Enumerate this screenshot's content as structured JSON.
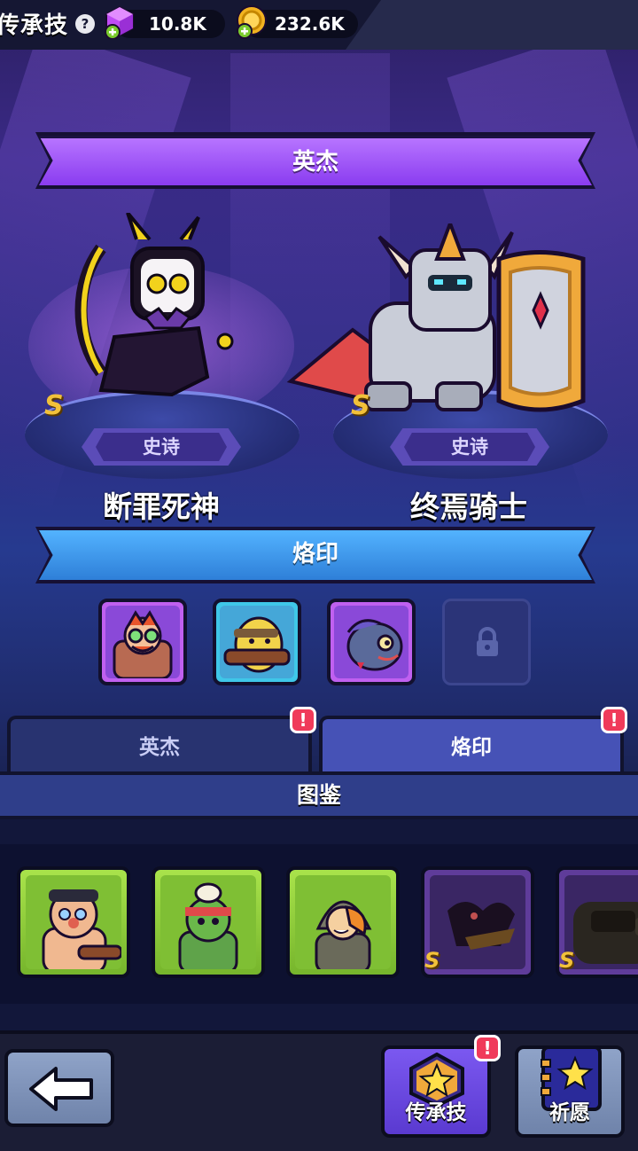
{
  "header": {
    "title": "传承技",
    "help_icon": "?",
    "gems": "10.8K",
    "coins": "232.6K"
  },
  "hero_section": {
    "banner": "英杰",
    "heroes": [
      {
        "name": "断罪死神",
        "rarity": "史诗",
        "tier": "S"
      },
      {
        "name": "终焉骑士",
        "rarity": "史诗",
        "tier": "S"
      }
    ]
  },
  "seal_section": {
    "banner": "烙印",
    "slots": [
      {
        "frame_color": "#c060f0",
        "locked": false
      },
      {
        "frame_color": "#3fc7e8",
        "locked": false
      },
      {
        "frame_color": "#c060f0",
        "locked": false
      },
      {
        "frame_color": "#2b3478",
        "locked": true
      }
    ]
  },
  "tabs": [
    {
      "label": "英杰",
      "alert": "!",
      "active": false
    },
    {
      "label": "烙印",
      "alert": "!",
      "active": true
    }
  ],
  "codex": {
    "title": "图鉴",
    "cards": [
      {
        "tier": "",
        "rarity_color": "green"
      },
      {
        "tier": "",
        "rarity_color": "green"
      },
      {
        "tier": "",
        "rarity_color": "green"
      },
      {
        "tier": "S",
        "rarity_color": "purple"
      },
      {
        "tier": "S",
        "rarity_color": "purple"
      }
    ]
  },
  "bottom_nav": {
    "legacy_label": "传承技",
    "legacy_alert": "!",
    "wish_label": "祈愿",
    "icons": [
      "back-arrow-icon",
      "star-badge-icon",
      "star-book-icon"
    ]
  },
  "colors": {
    "accent_purple": "#8a3cf0",
    "accent_blue": "#2e7fd8",
    "alert_red": "#f03a5a",
    "tier_gold": "#f2c13a"
  }
}
